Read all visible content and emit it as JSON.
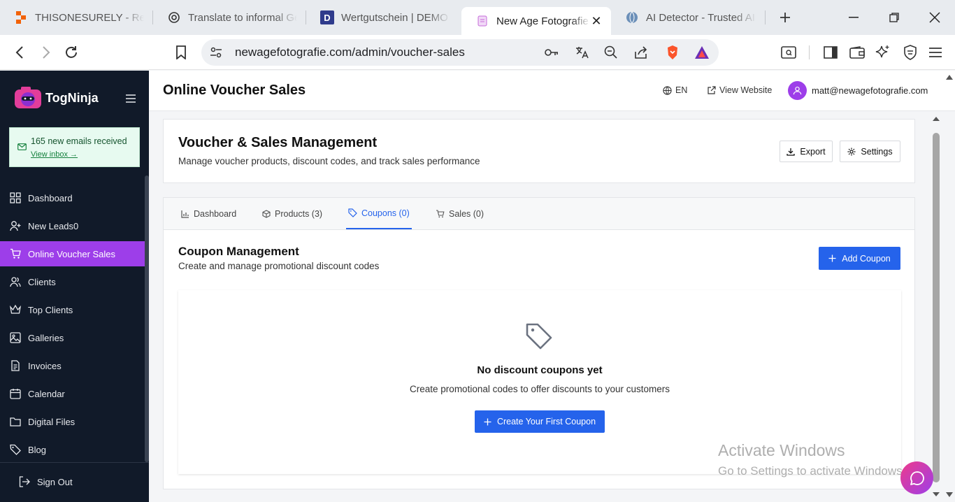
{
  "browser": {
    "tabs": [
      {
        "title": "THISONESURELY - Repli",
        "icon": "replit-icon"
      },
      {
        "title": "Translate to informal Ge",
        "icon": "openai-icon"
      },
      {
        "title": "Wertgutschein | DEMO S",
        "icon": "d-icon",
        "icon_text": "D"
      },
      {
        "title": "New Age Fotografie",
        "icon": "site-icon",
        "active": true
      },
      {
        "title": "AI Detector - Trusted AI",
        "icon": "globe-icon"
      }
    ],
    "url": "newagefotografie.com/admin/voucher-sales"
  },
  "sidebar": {
    "brand": "TogNinja",
    "notice": {
      "message": "165 new emails received",
      "link": "View inbox →"
    },
    "items": [
      {
        "label": "Dashboard",
        "icon": "dashboard-icon"
      },
      {
        "label": "New Leads0",
        "icon": "user-plus-icon"
      },
      {
        "label": "Online Voucher Sales",
        "icon": "cart-icon",
        "active": true
      },
      {
        "label": "Clients",
        "icon": "users-icon"
      },
      {
        "label": "Top Clients",
        "icon": "crown-icon"
      },
      {
        "label": "Galleries",
        "icon": "image-icon"
      },
      {
        "label": "Invoices",
        "icon": "file-icon"
      },
      {
        "label": "Calendar",
        "icon": "calendar-icon"
      },
      {
        "label": "Digital Files",
        "icon": "folder-icon"
      },
      {
        "label": "Blog",
        "icon": "tag-icon"
      }
    ],
    "signout": "Sign Out"
  },
  "header": {
    "title": "Online Voucher Sales",
    "language": "EN",
    "view_website": "View Website",
    "user_email": "matt@newagefotografie.com"
  },
  "management": {
    "title": "Voucher & Sales Management",
    "subtitle": "Manage voucher products, discount codes, and track sales performance",
    "export_label": "Export",
    "settings_label": "Settings"
  },
  "content_tabs": [
    {
      "label": "Dashboard",
      "icon": "chart-icon"
    },
    {
      "label": "Products (3)",
      "icon": "box-icon"
    },
    {
      "label": "Coupons (0)",
      "icon": "tag-icon",
      "active": true
    },
    {
      "label": "Sales (0)",
      "icon": "cart-icon"
    }
  ],
  "coupons": {
    "title": "Coupon Management",
    "subtitle": "Create and manage promotional discount codes",
    "add_label": "Add Coupon",
    "empty_title": "No discount coupons yet",
    "empty_subtitle": "Create promotional codes to offer discounts to your customers",
    "create_label": "Create Your First Coupon"
  },
  "watermark": {
    "line1": "Activate Windows",
    "line2": "Go to Settings to activate Windows."
  },
  "colors": {
    "accent": "#2563eb",
    "sidebar_bg": "#111a29",
    "sidebar_active": "#9d3ee9"
  }
}
